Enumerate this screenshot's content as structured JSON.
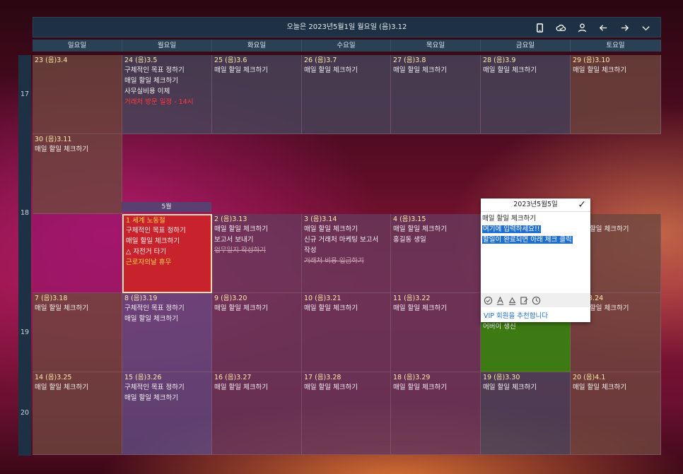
{
  "header": {
    "title": "오늘은 2023년5월1일 월요일 (음)3.12",
    "icons": [
      "mobile-icon",
      "cloud-sync-icon",
      "user-icon",
      "arrow-left-icon",
      "arrow-right-icon",
      "chevron-down-icon"
    ]
  },
  "days": [
    "일요일",
    "월요일",
    "화요일",
    "수요일",
    "목요일",
    "금요일",
    "토요일"
  ],
  "weeks": [
    "17",
    "18",
    "19",
    "20"
  ],
  "month_tag": "5월",
  "cells": {
    "w17": [
      {
        "date": "23 (음)3.4",
        "lines": []
      },
      {
        "date": "24 (음)3.5",
        "lines": [
          "구체적인 목표 정하기",
          "매일 할일 체크하기",
          "사무실비용 이체",
          "거래처 방문 일정 - 14시"
        ]
      },
      {
        "date": "25 (음)3.6",
        "lines": [
          "매일 할일 체크하기"
        ]
      },
      {
        "date": "26 (음)3.7",
        "lines": [
          "매일 할일 체크하기"
        ]
      },
      {
        "date": "27 (음)3.8",
        "lines": [
          "매일 할일 체크하기"
        ]
      },
      {
        "date": "28 (음)3.9",
        "lines": [
          "매일 할일 체크하기"
        ]
      },
      {
        "date": "29 (음)3.10",
        "lines": [
          "매일 할일 체크하기"
        ]
      }
    ],
    "w18_sun": {
      "date": "30 (음)3.11",
      "lines": [
        "매일 할일 체크하기"
      ]
    },
    "w18": [
      {
        "date": "",
        "lines": []
      },
      {
        "date": "1 세계 노동절",
        "lines": [
          "구체적인 목표 정하기",
          "매일 할일 체크하기",
          "자전거 타기",
          "근로자의날 휴무"
        ]
      },
      {
        "date": "2 (음)3.13",
        "lines": [
          "매일 할일 체크하기",
          "보고서 보내기",
          "업무일지 작성하기"
        ]
      },
      {
        "date": "3 (음)3.14",
        "lines": [
          "매일 할일 체크하기",
          "신규 거래처 마케팅 보고서",
          "작성",
          "거래처 비용 입금하기"
        ]
      },
      {
        "date": "4 (음)3.15",
        "lines": [
          "매일 할일 체크하기",
          "홍길동 생일"
        ]
      },
      {
        "date": "",
        "lines": []
      },
      {
        "date": "",
        "lines": [
          "할일 체크하기"
        ]
      }
    ],
    "w19": [
      {
        "date": "7 (음)3.18",
        "lines": [
          "매일 할일 체크하기"
        ]
      },
      {
        "date": "8 (음)3.19",
        "lines": [
          "구체적인 목표 정하기",
          "매일 할일 체크하기"
        ]
      },
      {
        "date": "9 (음)3.20",
        "lines": [
          "매일 할일 체크하기"
        ]
      },
      {
        "date": "10 (음)3.21",
        "lines": [
          "매일 할일 체크하기"
        ]
      },
      {
        "date": "11 (음)3.22",
        "lines": [
          "매일 할일 체크하기"
        ]
      },
      {
        "date": "",
        "lines": [
          "어버이 생신"
        ]
      },
      {
        "date": "3.24",
        "lines": [
          "할일 체크하기"
        ]
      }
    ],
    "w20": [
      {
        "date": "14 (음)3.25",
        "lines": [
          "매일 할일 체크하기"
        ]
      },
      {
        "date": "15 (음)3.26",
        "lines": [
          "구체적인 목표 정하기",
          "매일 할일 체크하기"
        ]
      },
      {
        "date": "16 (음)3.27",
        "lines": [
          "매일 할일 체크하기"
        ]
      },
      {
        "date": "17 (음)3.28",
        "lines": [
          "매일 할일 체크하기"
        ]
      },
      {
        "date": "18 (음)3.29",
        "lines": [
          "매일 할일 체크하기"
        ]
      },
      {
        "date": "19 (음)3.30",
        "lines": [
          "매일 할일 체크하기"
        ]
      },
      {
        "date": "20 (음)4.1",
        "lines": [
          "매일 할일 체크하기"
        ]
      }
    ]
  },
  "popup": {
    "title": "2023년5월5일",
    "line1": "매일 할일 체크하기",
    "line2": "여기에 입력하세요!!",
    "line3": "할일이 완료되면 아래 체크 클릭",
    "vip": "VIP 회원을 추천합니다",
    "tools": [
      "check-circle-icon",
      "text-color-icon",
      "highlight-icon",
      "edit-note-icon",
      "clock-icon"
    ]
  },
  "colors": {
    "accent": "#1f6fd1",
    "holiday_red": "#c8232d",
    "header_bg": "#1e3144"
  }
}
